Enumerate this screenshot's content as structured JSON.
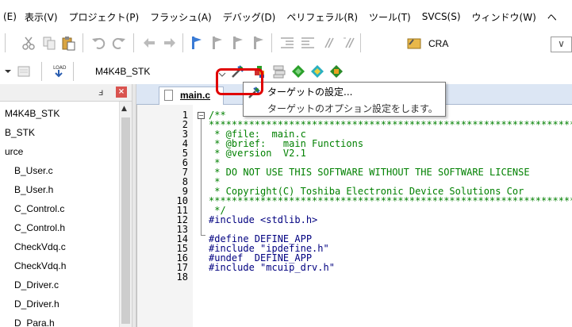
{
  "menu": {
    "items": [
      "(E)",
      "表示(V)",
      "プロジェクト(P)",
      "フラッシュ(A)",
      "デバッグ(D)",
      "ペリフェラル(R)",
      "ツール(T)",
      "SVCS(S)",
      "ウィンドウ(W)",
      "ヘ"
    ]
  },
  "toolbar1": {
    "target_options_label": "CRA",
    "dropdown_arrow": "∨"
  },
  "toolbar2": {
    "target_name": "M4K4B_STK",
    "load_label": "LOAD"
  },
  "project_pane": {
    "pin": "ⅎ",
    "close": "×",
    "items": [
      "M4K4B_STK",
      "B_STK",
      "urce",
      "B_User.c",
      "B_User.h",
      "C_Control.c",
      "C_Control.h",
      "CheckVdq.c",
      "CheckVdq.h",
      "D_Driver.c",
      "D_Driver.h",
      "D_Para.h"
    ]
  },
  "editor": {
    "tab_label": "main.c",
    "line_numbers": [
      "1",
      "2",
      "3",
      "4",
      "5",
      "6",
      "7",
      "8",
      "9",
      "10",
      "11",
      "12",
      "13",
      "14",
      "15",
      "16",
      "17",
      "18"
    ],
    "lines": [
      "/**",
      "*******************************************************************",
      " * @file:  main.c",
      " * @brief:   main Functions",
      " * @version  V2.1",
      " *",
      " * DO NOT USE THIS SOFTWARE WITHOUT THE SOFTWARE LICENSE",
      " *",
      " * Copyright(C) Toshiba Electronic Device Solutions Cor",
      "*******************************************************************",
      " */",
      "#include <stdlib.h>",
      "",
      "#define DEFINE_APP",
      "#include \"ipdefine.h\"",
      "#undef  DEFINE_APP",
      "#include \"mcuip_drv.h\"",
      ""
    ]
  },
  "tooltip": {
    "title": "ターゲットの設定...",
    "description": "ターゲットのオプション設定をします。"
  },
  "colors": {
    "highlight": "#e00000",
    "comment": "#008000",
    "tab_strip": "#dce6f4"
  }
}
